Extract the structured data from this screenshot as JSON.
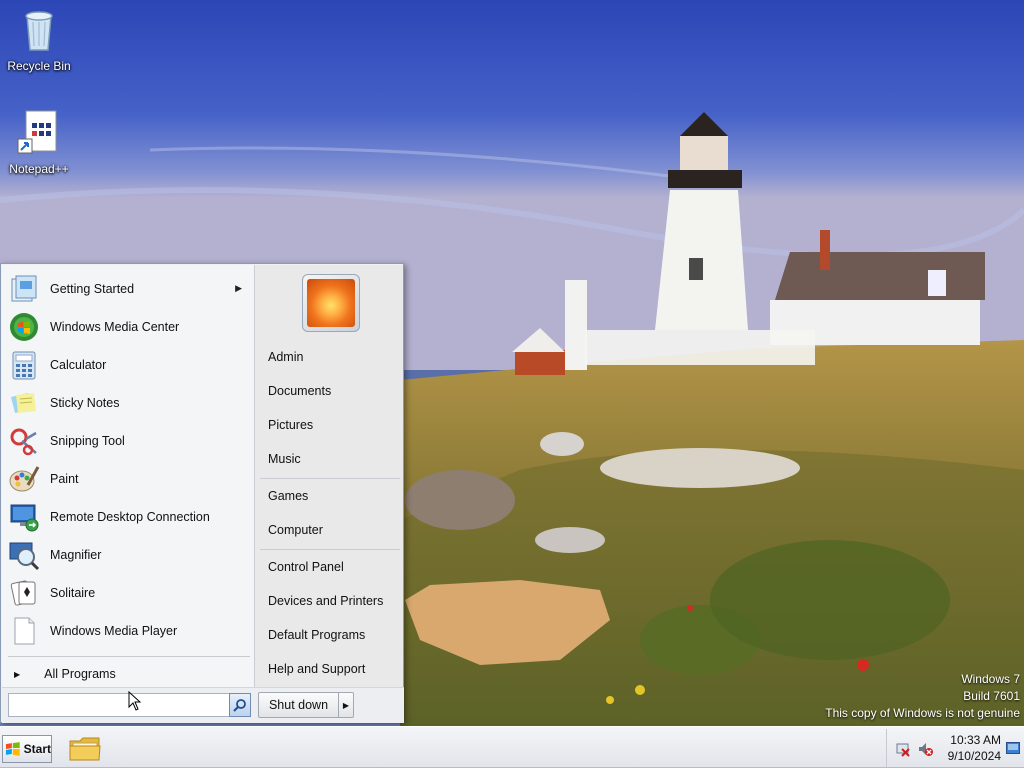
{
  "desktop": {
    "icons": [
      {
        "label": "Recycle Bin"
      },
      {
        "label": "Notepad++"
      }
    ],
    "watermark": {
      "line1": "Windows 7",
      "line2": "Build 7601",
      "line3": "This copy of Windows is not genuine"
    }
  },
  "start_menu": {
    "programs": [
      {
        "label": "Getting Started",
        "icon": "getting-started-icon",
        "has_submenu": true
      },
      {
        "label": "Windows Media Center",
        "icon": "media-center-icon"
      },
      {
        "label": "Calculator",
        "icon": "calculator-icon"
      },
      {
        "label": "Sticky Notes",
        "icon": "sticky-notes-icon"
      },
      {
        "label": "Snipping Tool",
        "icon": "snipping-tool-icon"
      },
      {
        "label": "Paint",
        "icon": "paint-icon"
      },
      {
        "label": "Remote Desktop Connection",
        "icon": "remote-desktop-icon"
      },
      {
        "label": "Magnifier",
        "icon": "magnifier-icon"
      },
      {
        "label": "Solitaire",
        "icon": "solitaire-icon"
      },
      {
        "label": "Windows Media Player",
        "icon": "media-player-icon"
      }
    ],
    "all_programs": "All Programs",
    "right_items": {
      "admin": "Admin",
      "documents": "Documents",
      "pictures": "Pictures",
      "music": "Music",
      "games": "Games",
      "computer": "Computer",
      "control_panel": "Control Panel",
      "devices_printers": "Devices and Printers",
      "default_programs": "Default Programs",
      "help_support": "Help and Support"
    },
    "search": {
      "value": "",
      "placeholder": ""
    },
    "shutdown_label": "Shut down"
  },
  "taskbar": {
    "start_label": "Start",
    "clock": {
      "time": "10:33 AM",
      "date": "9/10/2024"
    }
  },
  "colors": {
    "sky": "#3f5dc6",
    "start_menu_bg": "#f4f5f7",
    "right_pane_bg": "#e9e9ea",
    "taskbar_bg": "#e1e4ea"
  }
}
